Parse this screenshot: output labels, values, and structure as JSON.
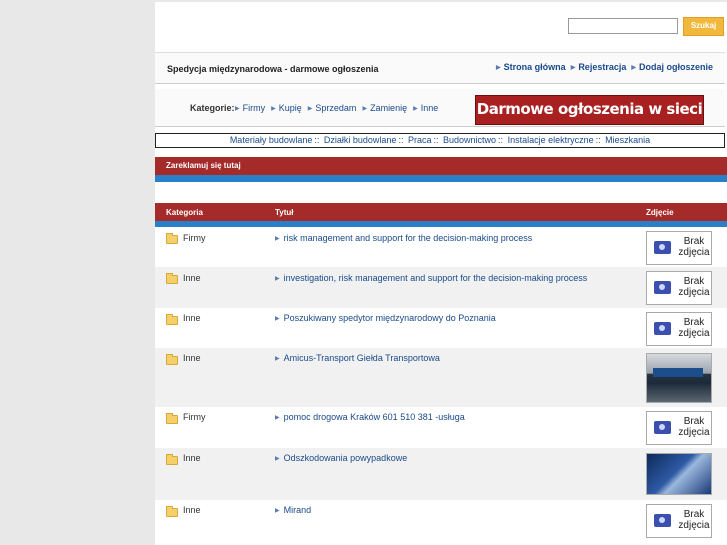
{
  "search": {
    "placeholder": "",
    "button": "Szukaj"
  },
  "header": {
    "site_title": "Spedycja międzynarodowa - darmowe ogłoszenia",
    "nav": [
      "Strona główna",
      "Rejestracja",
      "Dodaj ogłoszenie"
    ]
  },
  "categories": {
    "label": "Kategorie:",
    "items": [
      "Firmy",
      "Kupię",
      "Sprzedam",
      "Zamienię",
      "Inne"
    ],
    "banner": "Darmowe ogłoszenia w sieci !!"
  },
  "link_strip": [
    "Materiały budowlane",
    "Działki budowlane",
    "Praca",
    "Budownictwo",
    "Instalacje elektryczne",
    "Mieszkania"
  ],
  "ad": {
    "label": "Zareklamuj się tutaj"
  },
  "table": {
    "headers": {
      "category": "Kategoria",
      "title": "Tytuł",
      "photo": "Zdjęcie"
    },
    "no_photo_label": "Brak zdjęcia",
    "rows": [
      {
        "category": "Firmy",
        "title": "risk management and support for the decision-making process",
        "photo": "none"
      },
      {
        "category": "Inne",
        "title": "investigation, risk management and support for the decision-making process",
        "photo": "none"
      },
      {
        "category": "Inne",
        "title": "Poszukiwany spedytor międzynarodowy do Poznania",
        "photo": "none"
      },
      {
        "category": "Inne",
        "title": "Amicus-Transport Giełda Transportowa",
        "photo": "truck"
      },
      {
        "category": "Firmy",
        "title": "pomoc drogowa Kraków 601 510 381 -usługa",
        "photo": "none"
      },
      {
        "category": "Inne",
        "title": "Odszkodowania powypadkowe",
        "photo": "handshake"
      },
      {
        "category": "Inne",
        "title": "Mirand",
        "photo": "none"
      }
    ]
  }
}
